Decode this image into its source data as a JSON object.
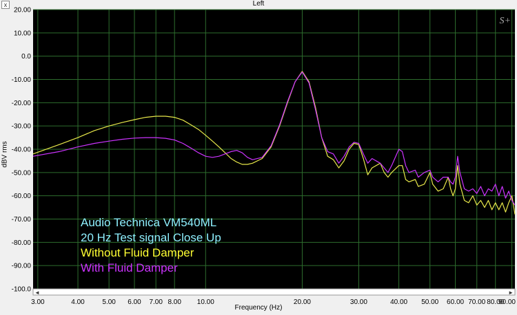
{
  "window": {
    "title": "Left",
    "close_glyph": "x"
  },
  "chart_data": {
    "type": "line",
    "title": "Left",
    "xlabel": "Frequency (Hz)",
    "ylabel": "dBV rms",
    "x_scale": "log",
    "xlim": [
      2.9,
      92
    ],
    "ylim": [
      -100,
      20
    ],
    "grid": true,
    "background": "#000000",
    "grid_color": "#2e6e2e",
    "y_ticks": [
      20,
      10,
      0,
      -10,
      -20,
      -30,
      -40,
      -50,
      -60,
      -70,
      -80,
      -90,
      -100
    ],
    "y_tick_labels": [
      "20.00",
      "10.00",
      "0.0",
      "-10.00",
      "-20.00",
      "-30.00",
      "-40.00",
      "-50.00",
      "-60.00",
      "-70.00",
      "-80.00",
      "-90.00",
      "-100.0"
    ],
    "x_ticks": [
      3,
      4,
      5,
      6,
      7,
      8,
      10,
      20,
      30,
      40,
      50,
      60,
      70,
      80,
      90
    ],
    "x_tick_labels": [
      "3.00",
      "4.00",
      "5.00",
      "6.00",
      "7.00",
      "8.00",
      "10.00",
      "20.00",
      "30.00",
      "40.00",
      "50.00",
      "60.00",
      "70.00",
      "80.00",
      "90.00"
    ],
    "annotations": [
      {
        "text": "Audio Technica VM540ML",
        "color": "#8ff0ff"
      },
      {
        "text": "20 Hz Test signal Close Up",
        "color": "#8ff0ff"
      },
      {
        "text": "Without Fluid Damper",
        "color": "#ffff33"
      },
      {
        "text": "With Fluid Damper",
        "color": "#cc33ff"
      }
    ],
    "logo": "S+",
    "series": [
      {
        "color": "#e8e84a",
        "points": [
          [
            2.9,
            -42
          ],
          [
            3.5,
            -38
          ],
          [
            4,
            -35
          ],
          [
            4.5,
            -32
          ],
          [
            5,
            -30
          ],
          [
            5.5,
            -28.5
          ],
          [
            6,
            -27.3
          ],
          [
            6.5,
            -26.3
          ],
          [
            7,
            -25.8
          ],
          [
            7.5,
            -25.8
          ],
          [
            8,
            -26.3
          ],
          [
            8.5,
            -27.5
          ],
          [
            9,
            -29.5
          ],
          [
            9.5,
            -31.5
          ],
          [
            10,
            -34
          ],
          [
            10.5,
            -36.5
          ],
          [
            11,
            -39
          ],
          [
            11.5,
            -41.5
          ],
          [
            12,
            -44
          ],
          [
            12.5,
            -45.5
          ],
          [
            13,
            -46.5
          ],
          [
            13.5,
            -46.5
          ],
          [
            14,
            -46
          ],
          [
            15,
            -44
          ],
          [
            16,
            -39
          ],
          [
            17,
            -30
          ],
          [
            18,
            -20
          ],
          [
            19,
            -11
          ],
          [
            20,
            -6.5
          ],
          [
            21,
            -11
          ],
          [
            22,
            -22
          ],
          [
            23,
            -35
          ],
          [
            24,
            -43
          ],
          [
            25,
            -44.5
          ],
          [
            26,
            -48
          ],
          [
            27,
            -45
          ],
          [
            28,
            -40
          ],
          [
            29,
            -37.5
          ],
          [
            30,
            -38
          ],
          [
            31,
            -44
          ],
          [
            32,
            -51
          ],
          [
            33,
            -48
          ],
          [
            35,
            -46
          ],
          [
            36,
            -50
          ],
          [
            37,
            -52
          ],
          [
            38,
            -50
          ],
          [
            40,
            -47
          ],
          [
            41,
            -47
          ],
          [
            42,
            -53
          ],
          [
            43,
            -54
          ],
          [
            45,
            -53
          ],
          [
            46,
            -56
          ],
          [
            48,
            -55
          ],
          [
            50,
            -50
          ],
          [
            51,
            -55
          ],
          [
            53,
            -58
          ],
          [
            55,
            -57
          ],
          [
            57,
            -52
          ],
          [
            58,
            -57
          ],
          [
            59,
            -60
          ],
          [
            60,
            -57
          ],
          [
            61,
            -47
          ],
          [
            62,
            -55
          ],
          [
            64,
            -62
          ],
          [
            66,
            -63
          ],
          [
            68,
            -60
          ],
          [
            70,
            -64
          ],
          [
            72,
            -62
          ],
          [
            74,
            -65
          ],
          [
            76,
            -62
          ],
          [
            78,
            -66
          ],
          [
            80,
            -63
          ],
          [
            82,
            -66
          ],
          [
            84,
            -63
          ],
          [
            86,
            -67
          ],
          [
            88,
            -63
          ],
          [
            90,
            -60
          ],
          [
            92,
            -68
          ]
        ]
      },
      {
        "color": "#cc33ff",
        "points": [
          [
            2.9,
            -43
          ],
          [
            3.5,
            -41
          ],
          [
            4,
            -39
          ],
          [
            4.5,
            -37.5
          ],
          [
            5,
            -36.5
          ],
          [
            5.5,
            -35.7
          ],
          [
            6,
            -35.2
          ],
          [
            6.5,
            -35
          ],
          [
            7,
            -35
          ],
          [
            7.5,
            -35.3
          ],
          [
            8,
            -36
          ],
          [
            8.5,
            -37.5
          ],
          [
            9,
            -39.5
          ],
          [
            9.5,
            -41.5
          ],
          [
            10,
            -43
          ],
          [
            10.5,
            -43.5
          ],
          [
            11,
            -43
          ],
          [
            11.5,
            -42
          ],
          [
            12,
            -41
          ],
          [
            12.5,
            -40.5
          ],
          [
            13,
            -41.5
          ],
          [
            13.5,
            -43.5
          ],
          [
            14,
            -44.5
          ],
          [
            15,
            -43.5
          ],
          [
            16,
            -38.5
          ],
          [
            17,
            -29.5
          ],
          [
            18,
            -19.5
          ],
          [
            19,
            -11
          ],
          [
            20,
            -6.8
          ],
          [
            21,
            -11.5
          ],
          [
            22,
            -23
          ],
          [
            23,
            -35
          ],
          [
            24,
            -41
          ],
          [
            25,
            -42
          ],
          [
            26,
            -46
          ],
          [
            27,
            -43
          ],
          [
            28,
            -39
          ],
          [
            29,
            -37
          ],
          [
            30,
            -37.5
          ],
          [
            31,
            -42
          ],
          [
            32,
            -46
          ],
          [
            33,
            -44
          ],
          [
            35,
            -46
          ],
          [
            36,
            -48
          ],
          [
            37,
            -50
          ],
          [
            38,
            -47
          ],
          [
            40,
            -40
          ],
          [
            41,
            -41
          ],
          [
            42,
            -47
          ],
          [
            43,
            -50
          ],
          [
            45,
            -49
          ],
          [
            46,
            -52
          ],
          [
            48,
            -50
          ],
          [
            50,
            -49
          ],
          [
            51,
            -52
          ],
          [
            53,
            -54
          ],
          [
            55,
            -52
          ],
          [
            57,
            -52
          ],
          [
            58,
            -54
          ],
          [
            59,
            -55
          ],
          [
            60,
            -52
          ],
          [
            61,
            -43
          ],
          [
            62,
            -50
          ],
          [
            64,
            -57
          ],
          [
            66,
            -58
          ],
          [
            68,
            -57
          ],
          [
            70,
            -59
          ],
          [
            72,
            -56
          ],
          [
            74,
            -60
          ],
          [
            76,
            -57
          ],
          [
            78,
            -58
          ],
          [
            80,
            -55
          ],
          [
            82,
            -60
          ],
          [
            84,
            -56
          ],
          [
            86,
            -61
          ],
          [
            88,
            -58
          ],
          [
            90,
            -62
          ],
          [
            92,
            -64
          ]
        ]
      }
    ]
  }
}
